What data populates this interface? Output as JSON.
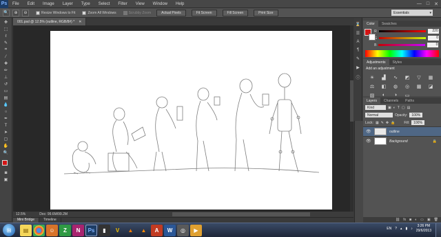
{
  "app": {
    "logo": "Ps"
  },
  "menu": {
    "items": [
      "File",
      "Edit",
      "Image",
      "Layer",
      "Type",
      "Select",
      "Filter",
      "View",
      "Window",
      "Help"
    ]
  },
  "window_controls": {
    "minimize": "—",
    "maximize": "□",
    "close": "✕"
  },
  "options_bar": {
    "checks": [
      {
        "label": "Resize Windows to Fit",
        "checked": false,
        "disabled": false
      },
      {
        "label": "Zoom All Windows",
        "checked": false,
        "disabled": false
      },
      {
        "label": "Scrubby Zoom",
        "checked": false,
        "disabled": true
      }
    ],
    "buttons": [
      "Actual Pixels",
      "Fit Screen",
      "Fill Screen",
      "Print Size"
    ],
    "workspace": "Essentials"
  },
  "document": {
    "tab_title": "001.psd @ 12.5% (outline, RGB/8#) *",
    "zoom": "12.5%",
    "doc_info": "Doc: 99.6M/99.2M"
  },
  "bottom_tabs": [
    "Mini Bridge",
    "Timeline"
  ],
  "color_panel": {
    "tabs": [
      "Color",
      "Swatches"
    ],
    "r_value": "220",
    "g_value": "0",
    "b_value": "0",
    "foreground": "#d21414",
    "background": "#ffffff"
  },
  "adjustments_panel": {
    "tabs": [
      "Adjustments",
      "Styles"
    ],
    "title": "Add an adjustment"
  },
  "layers_panel": {
    "tabs": [
      "Layers",
      "Channels",
      "Paths"
    ],
    "filter_label": "Kind",
    "blend_mode": "Normal",
    "opacity_label": "Opacity:",
    "opacity_value": "100%",
    "lock_label": "Lock:",
    "fill_label": "Fill:",
    "fill_value": "100%",
    "layers": [
      {
        "name": "outline",
        "selected": true
      },
      {
        "name": "Background",
        "selected": false
      }
    ]
  },
  "taskbar": {
    "language": "EN",
    "time": "3:26 PM",
    "date": "29/6/2013"
  }
}
